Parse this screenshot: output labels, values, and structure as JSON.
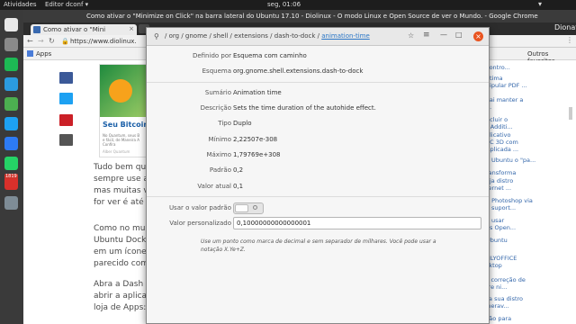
{
  "topbar": {
    "activities": "Atividades",
    "app_menu": "Editor dconf ▾",
    "clock": "seg, 01:06",
    "user": "Dionatan"
  },
  "chrome": {
    "window_title": "Como ativar o \"Minimize on Click\" na barra lateral do Ubuntu 17.10 - Diolinux - O modo Linux e Open Source de ver o Mundo. - Google Chrome",
    "tab_title": "Como ativar o \"Mini",
    "url": "https://www.diolinux.",
    "bookmarks": [
      {
        "label": "Apps"
      },
      {
        "label": "Outros favoritos"
      }
    ]
  },
  "dock": {
    "items": [
      {
        "name": "chrome-launcher",
        "color": "#e8e8e8"
      },
      {
        "name": "files-launcher",
        "color": "#8a8a8a"
      },
      {
        "name": "spotify-launcher",
        "color": "#1db954"
      },
      {
        "name": "skype-launcher",
        "color": "#2b9be0"
      },
      {
        "name": "terminal-launcher",
        "color": "#4caf50"
      },
      {
        "name": "twitter-launcher",
        "color": "#1da1f2"
      },
      {
        "name": "messenger-launcher",
        "color": "#2d7bf4"
      },
      {
        "name": "whatsapp-launcher",
        "color": "#25d366"
      },
      {
        "name": "update-launcher",
        "color": "#d9302b",
        "badge": "1819"
      },
      {
        "name": "settings-launcher",
        "color": "#7e8c96"
      }
    ]
  },
  "article": {
    "box_title": "Seu Bitcoin",
    "box_text_1": "No Quantum, seus B",
    "box_text_2": "e fácil, de Maneira A",
    "box_text_3": "Confira",
    "box_source": "Alber Quantum",
    "lines": [
      "Tudo bem que",
      "sempre use a te",
      "mas muitas vezes",
      "for ver é até um",
      "Como no mundo",
      "Ubuntu Dock ta",
      "em um ícone na",
      "parecido com qu",
      "Abra a Dash (ou",
      "abrir a aplicaçã",
      "loja de Apps:"
    ]
  },
  "sidebar": {
    "items": [
      "contro...",
      "ótima",
      "nipular PDF ...",
      "vai manter a",
      "...",
      "ncluir o",
      "r Additi...",
      "plicativo",
      "SC 3D com",
      "Aplicada ...",
      "o Ubuntu o \"pa...",
      "ransforma",
      "eja distro",
      "ternet ...",
      "e Photoshop via",
      "o suport...",
      "a usar",
      "es Open...",
      "Ubuntu",
      "NLYOFFICE",
      "sktop",
      "s correção de",
      "tre ni...",
      "Como verificar se a sua distro",
      "Linux está vulnerav...",
      "Google cria correção para"
    ]
  },
  "dialog": {
    "breadcrumb": [
      {
        "label": "/"
      },
      {
        "label": "org"
      },
      {
        "label": "/"
      },
      {
        "label": "gnome"
      },
      {
        "label": "/"
      },
      {
        "label": "shell"
      },
      {
        "label": "/"
      },
      {
        "label": "extensions"
      },
      {
        "label": "/"
      },
      {
        "label": "dash-to-dock"
      },
      {
        "label": "/"
      },
      {
        "label": "animation-time"
      }
    ],
    "rows": [
      {
        "label": "Definido por",
        "value": "Esquema com caminho"
      },
      {
        "label": "Esquema",
        "value": "org.gnome.shell.extensions.dash-to-dock"
      },
      {
        "label": "Sumário",
        "value": "Animation time"
      },
      {
        "label": "Descrição",
        "value": "Sets the time duration of the autohide effect."
      },
      {
        "label": "Tipo",
        "value": "Duplo"
      },
      {
        "label": "Mínimo",
        "value": "2,22507e-308"
      },
      {
        "label": "Máximo",
        "value": "1,79769e+308"
      },
      {
        "label": "Padrão",
        "value": "0,2"
      },
      {
        "label": "Valor atual",
        "value": "0,1"
      }
    ],
    "use_default_label": "Usar o valor padrão",
    "use_default_toggle": "off",
    "custom_value_label": "Valor personalizado",
    "custom_value": "0,10000000000000001",
    "hint_line1": "Use um ponto como marca de decimal e sem separador de milhares. Você pode usar a",
    "hint_line2": "notação X.Ye+Z."
  }
}
